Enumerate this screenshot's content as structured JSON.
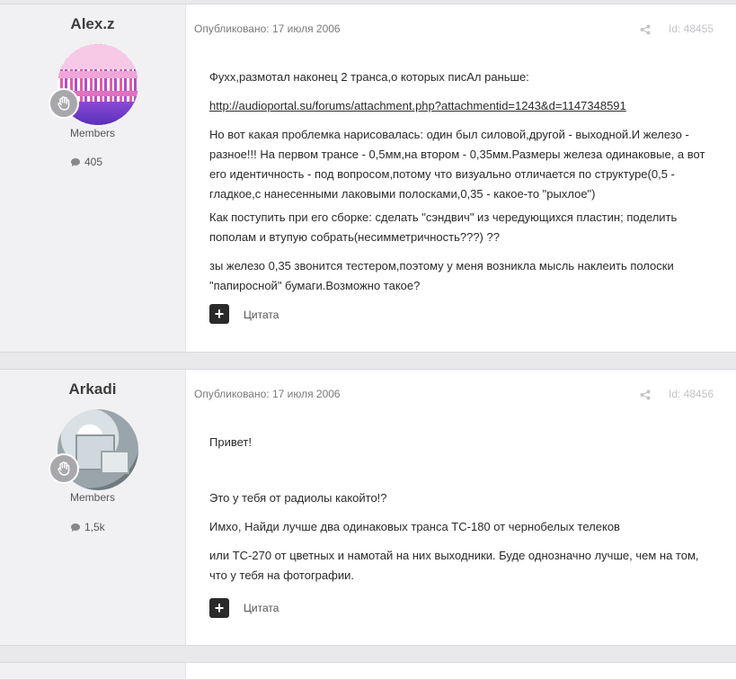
{
  "posts": [
    {
      "author": "Alex.z",
      "group": "Members",
      "post_count": "405",
      "published": "Опубликовано: 17 июля 2006",
      "id": "Id: 48455",
      "paragraphs": [
        "Фухх,размотал наконец 2 транса,о которых писАл раньше:",
        "http://audioportal.su/forums/attachment.php?attachmentid=1243&d=1147348591",
        "Но вот какая проблемка нарисовалась: один был силовой,другой - выходной.И железо - разное!!! На первом трансе - 0,5мм,на втором - 0,35мм.Размеры железа одинаковые, а вот его идентичность - под вопросом,потому что визуально отличается по структуре(0,5 - гладкое,с нанесенными лаковыми полосками,0,35 - какое-то \"рыхлое\")",
        "Как поступить при его сборке: сделать \"сэндвич\" из чередующихся пластин; поделить пополам и втупую собрать(несимметричность???) ??",
        "зы железо 0,35 звонится тестером,поэтому у меня возникла мысль наклеить полоски \"папиросной\" бумаги.Возможно такое?"
      ],
      "quote_label": "Цитата"
    },
    {
      "author": "Arkadi",
      "group": "Members",
      "post_count": "1,5k",
      "published": "Опубликовано: 17 июля 2006",
      "id": "Id: 48456",
      "paragraphs": [
        "Привет!",
        "Это у тебя от радиолы какойто!?",
        "Имхо, Найди лучше два одинаковых транса ТС-180 от чернобелых телеков",
        "или ТС-270 от цветных и намотай на них выходники. Буде однозначно лучше, чем на том, что у тебя на фотографии."
      ],
      "quote_label": "Цитата"
    }
  ],
  "icons": {
    "badge": "hand-wave-icon",
    "count": "comment-icon",
    "share": "share-icon",
    "quote": "plus-icon"
  }
}
